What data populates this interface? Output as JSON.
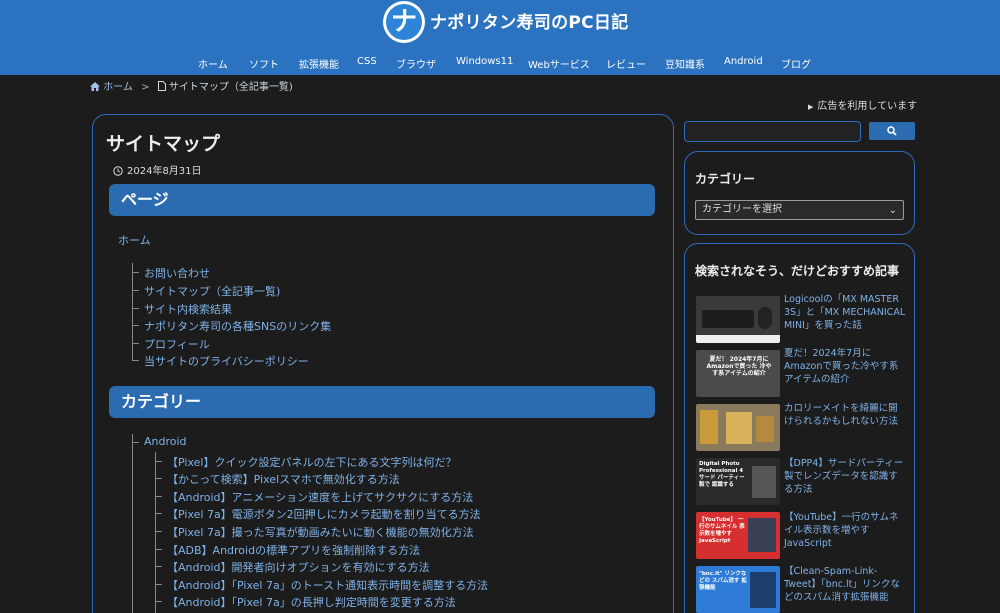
{
  "header": {
    "logo_glyph": "ナ",
    "site_title": "ナポリタン寿司のPC日記",
    "nav": [
      "ホーム",
      "ソフト",
      "拡張機能",
      "CSS",
      "ブラウザ",
      "Windows11",
      "Webサービス",
      "レビュー",
      "豆知識系",
      "Android",
      "ブログ"
    ]
  },
  "breadcrumb": {
    "home": "ホーム",
    "separator": ">",
    "current": "サイトマップ（全記事一覧)"
  },
  "ad_note": "広告を利用しています",
  "article": {
    "title": "サイトマップ",
    "date": "2024年8月31日",
    "pages_heading": "ページ",
    "home_link": "ホーム",
    "pages": [
      "お問い合わせ",
      "サイトマップ（全記事一覧)",
      "サイト内検索結果",
      "ナポリタン寿司の各種SNSのリンク集",
      "プロフィール",
      "当サイトのプライバシーポリシー"
    ],
    "categories_heading": "カテゴリー",
    "category_name": "Android",
    "posts": [
      "【Pixel】クイック設定パネルの左下にある文字列は何だ？",
      "【かこって検索】Pixelスマホで無効化する方法",
      "【Android】アニメーション速度を上げてサクサクにする方法",
      "【Pixel 7a】電源ボタン2回押しにカメラ起動を割り当てる方法",
      "【Pixel 7a】撮った写真が動画みたいに動く機能の無効化方法",
      "【ADB】Androidの標準アプリを強制削除する方法",
      "【Android】開発者向けオプションを有効にする方法",
      "【Android】「Pixel 7a」のトースト通知表示時間を調整する方法",
      "【Android】「Pixel 7a」の長押し判定時間を変更する方法"
    ]
  },
  "sidebar": {
    "search_placeholder": "",
    "categories_title": "カテゴリー",
    "category_select": "カテゴリーを選択",
    "recommend_title": "検索されなそう、だけどおすすめ記事",
    "recommendations": [
      "Logicoolの「MX MASTER 3S」と「MX MECHANICAL MINI」を買った話",
      "夏だ！2024年7月にAmazonで買った冷やす系アイテムの紹介",
      "カロリーメイトを綺麗に開けられるかもしれない方法",
      "【DPP4】サードパーティー製でレンズデータを認識する方法",
      "【YouTube】一行のサムネイル表示数を増やすJavaScript",
      "【Clean-Spam-Link-Tweet】「bnc.lt」リンクなどのスパム消す拡張機能"
    ],
    "thumb_captions": [
      "",
      "夏だ！ 2024年7月に Amazonで買った 冷やす系アイテムの紹介",
      "",
      "Digital Photo Professional 4 サード パーティー製で 認識する",
      "【YouTube】 一行のサムネイル 表示数を増やす JavaScript",
      "\"bnc.lt\" リンクなどの スパム消す 拡張機能"
    ]
  },
  "colors": {
    "header_blue": "#2b72c0",
    "accent_blue": "#2b6cb0",
    "link_blue": "#7fb2e8",
    "background": "#1c1c1c"
  }
}
